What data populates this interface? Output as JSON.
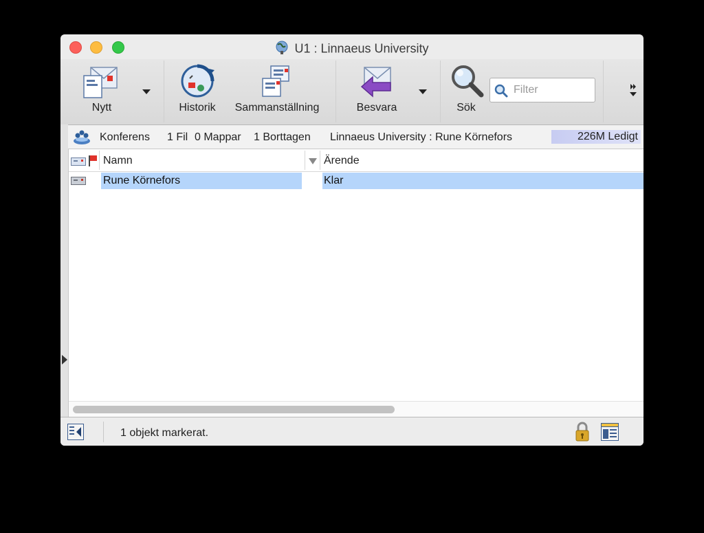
{
  "window": {
    "title": "U1 : Linnaeus University"
  },
  "toolbar": {
    "new_label": "Nytt",
    "history_label": "Historik",
    "summary_label": "Sammanställning",
    "reply_label": "Besvara",
    "search_label": "Sök",
    "filter_placeholder": "Filter"
  },
  "infobar": {
    "type": "Konferens",
    "files": "1 Fil",
    "folders": "0 Mappar",
    "deleted": "1 Borttagen",
    "location": "Linnaeus University : Rune Körnefors",
    "free_space": "226M Ledigt"
  },
  "list": {
    "columns": [
      "Namn",
      "Ärende"
    ],
    "rows": [
      {
        "name": "Rune Körnefors",
        "subject": "Klar",
        "selected": true
      }
    ]
  },
  "status": {
    "text": "1 objekt markerat."
  },
  "colors": {
    "selection": "#b5d5fb",
    "close": "#fc605b",
    "minimize": "#fdbc40",
    "maximize": "#34c84a"
  }
}
